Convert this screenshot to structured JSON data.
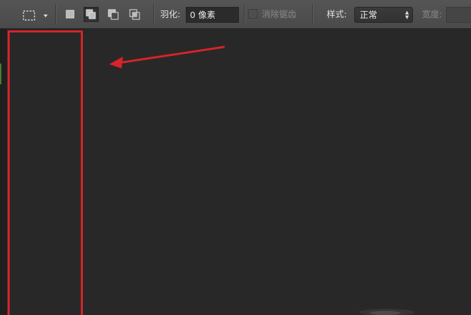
{
  "toolbar": {
    "tool_icon": "rectangular-marquee-icon",
    "selection_modes": [
      {
        "name": "new-selection",
        "icon": "new-selection-icon",
        "active": false
      },
      {
        "name": "add-to-selection",
        "icon": "add-to-selection-icon",
        "active": true
      },
      {
        "name": "subtract-from-selection",
        "icon": "subtract-from-selection-icon",
        "active": false
      },
      {
        "name": "intersect-with-selection",
        "icon": "intersect-selection-icon",
        "active": false
      }
    ],
    "feather_label": "羽化:",
    "feather_value": "0 像素",
    "antialias_label": "消除锯齿",
    "antialias_checked": false,
    "style_label": "样式:",
    "style_value": "正常",
    "width_label": "宽度:"
  },
  "annotation": {
    "highlight_color": "#d8232a"
  },
  "colors": {
    "toolbar_bg": "#4e4e4e",
    "canvas_bg": "#282828",
    "accent_red": "#d8232a"
  }
}
